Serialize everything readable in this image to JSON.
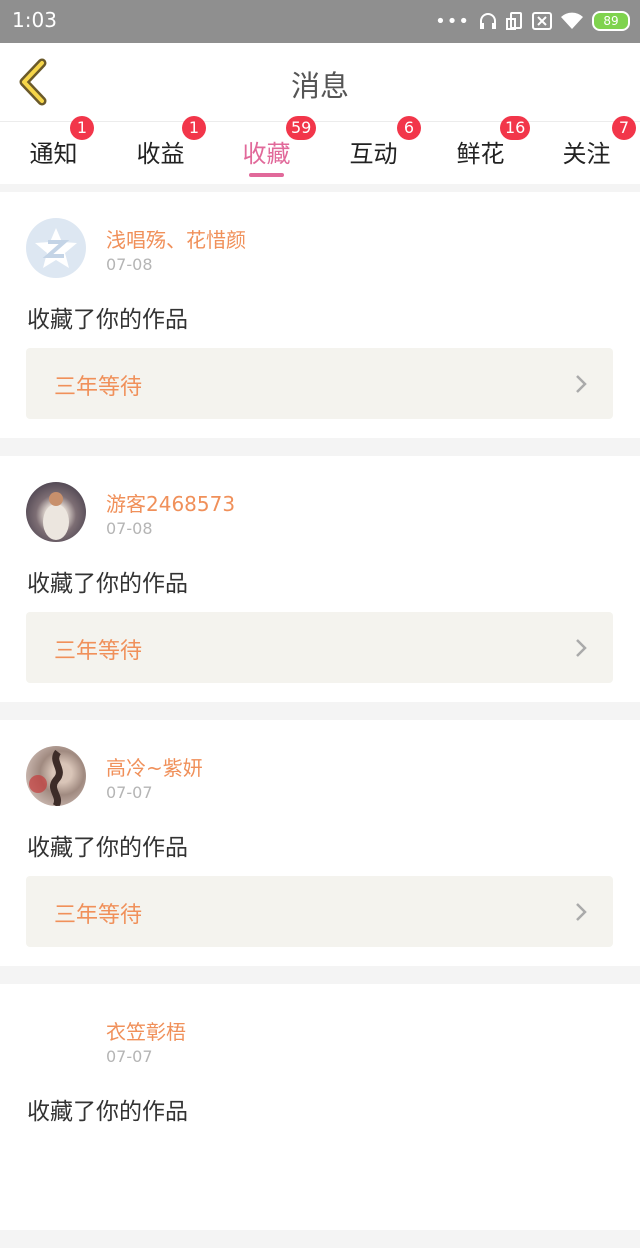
{
  "status_bar": {
    "time": "1:03",
    "battery": "89"
  },
  "header": {
    "title": "消息"
  },
  "tabs": [
    {
      "label": "通知",
      "badge": "1"
    },
    {
      "label": "收益",
      "badge": "1"
    },
    {
      "label": "收藏",
      "badge": "59",
      "active": true
    },
    {
      "label": "互动",
      "badge": "6"
    },
    {
      "label": "鲜花",
      "badge": "16"
    },
    {
      "label": "关注",
      "badge": "7"
    }
  ],
  "messages": [
    {
      "user": "浅唱殇、花惜颜",
      "date": "07-08",
      "action": "收藏了你的作品",
      "work": "三年等待",
      "avatar_icon": "default-avatar-icon"
    },
    {
      "user": "游客2468573",
      "date": "07-08",
      "action": "收藏了你的作品",
      "work": "三年等待",
      "avatar_icon": "photo-avatar"
    },
    {
      "user": "高冷~紫妍",
      "date": "07-07",
      "action": "收藏了你的作品",
      "work": "三年等待",
      "avatar_icon": "photo-avatar"
    },
    {
      "user": "衣笠彰梧",
      "date": "07-07",
      "action": "收藏了你的作品",
      "work": "",
      "avatar_icon": ""
    }
  ],
  "colors": {
    "accent": "#e1699a",
    "badge": "#f2364a",
    "username": "#f0905a"
  }
}
